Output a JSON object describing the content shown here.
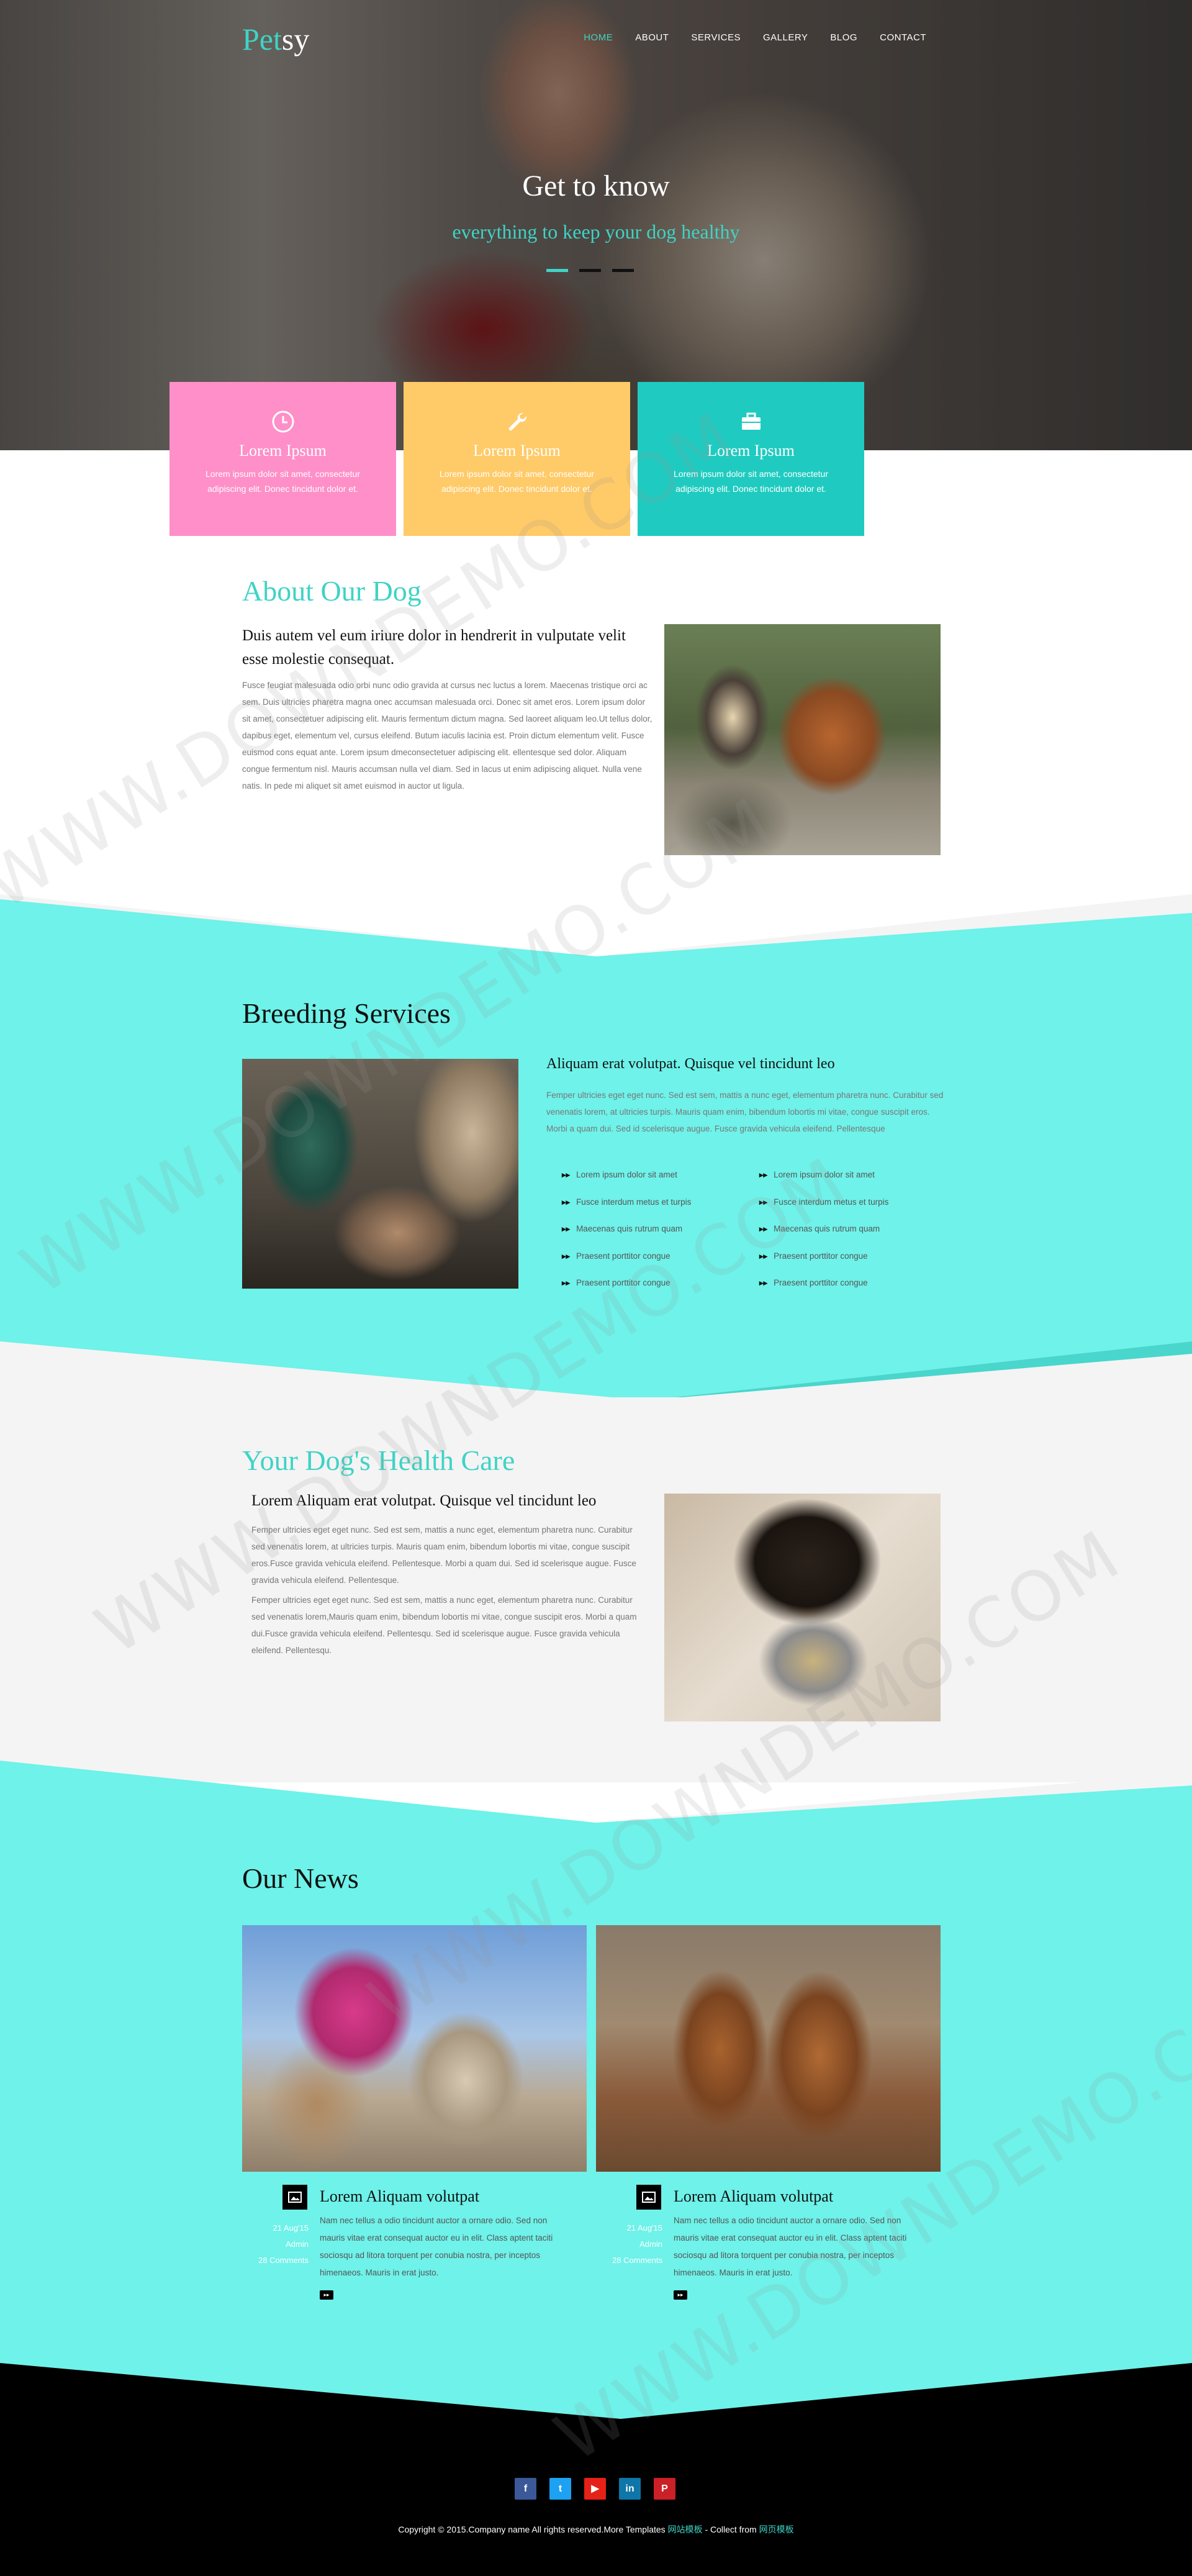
{
  "brand": {
    "part1": "Pet",
    "part2": "sy"
  },
  "nav": [
    {
      "label": "HOME",
      "active": true
    },
    {
      "label": "ABOUT",
      "active": false
    },
    {
      "label": "SERVICES",
      "active": false
    },
    {
      "label": "GALLERY",
      "active": false
    },
    {
      "label": "BLOG",
      "active": false
    },
    {
      "label": "CONTACT",
      "active": false
    }
  ],
  "hero": {
    "title": "Get to know",
    "subtitle": "everything to keep your dog healthy"
  },
  "features": [
    {
      "icon": "clock-icon",
      "title": "Lorem Ipsum",
      "text": "Lorem ipsum dolor sit amet, consectetur adipiscing elit. Donec tincidunt dolor et.",
      "color": "#ff8fc8"
    },
    {
      "icon": "wrench-icon",
      "title": "Lorem Ipsum",
      "text": "Lorem ipsum dolor sit amet, consectetur adipiscing elit. Donec tincidunt dolor et.",
      "color": "#ffca68"
    },
    {
      "icon": "briefcase-icon",
      "title": "Lorem Ipsum",
      "text": "Lorem ipsum dolor sit amet, consectetur adipiscing elit. Donec tincidunt dolor et.",
      "color": "#1fcbc0"
    }
  ],
  "about": {
    "title": "About Our Dog",
    "lead": "Duis autem vel eum iriure dolor in hendrerit in vulputate velit esse molestie consequat.",
    "text": "Fusce feugiat malesuada odio orbi nunc odio gravida at cursus nec luctus a lorem. Maecenas tristique orci ac sem. Duis ultricies pharetra magna onec accumsan malesuada orci. Donec sit amet eros. Lorem ipsum dolor sit amet, consectetuer adipiscing elit. Mauris fermentum dictum magna. Sed laoreet aliquam leo.Ut tellus dolor, dapibus eget, elementum vel, cursus eleifend. Butum iaculis lacinia est. Proin dictum elementum velit. Fusce euismod cons equat ante. Lorem ipsum dmeconsectetuer adipiscing elit. ellentesque sed dolor. Aliquam congue fermentum nisl. Mauris accumsan nulla vel diam. Sed in lacus ut enim adipiscing aliquet. Nulla vene natis. In pede mi aliquet sit amet euismod in auctor ut ligula."
  },
  "breeding": {
    "title": "Breeding Services",
    "lead": "Aliquam erat volutpat. Quisque vel tincidunt leo",
    "text": "Femper ultricies eget eget nunc. Sed est sem, mattis a nunc eget, elementum pharetra nunc. Curabitur sed venenatis lorem, at ultricies turpis. Mauris quam enim, bibendum lobortis mi vitae, congue suscipit eros. Morbi a quam dui. Sed id scelerisque augue. Fusce gravida vehicula eleifend. Pellentesque",
    "list_left": [
      "Lorem ipsum dolor sit amet",
      "Fusce interdum metus et turpis",
      "Maecenas quis rutrum quam",
      "Praesent porttitor congue",
      "Praesent porttitor congue"
    ],
    "list_right": [
      "Lorem ipsum dolor sit amet",
      "Fusce interdum metus et turpis",
      "Maecenas quis rutrum quam",
      "Praesent porttitor congue",
      "Praesent porttitor congue"
    ]
  },
  "health": {
    "title": "Your Dog's Health Care",
    "lead": "Lorem Aliquam erat volutpat. Quisque vel tincidunt leo",
    "text1": "Femper ultricies eget eget nunc. Sed est sem, mattis a nunc eget, elementum pharetra nunc. Curabitur sed venenatis lorem, at ultricies turpis. Mauris quam enim, bibendum lobortis mi vitae, congue suscipit eros.Fusce gravida vehicula eleifend. Pellentesque. Morbi a quam dui. Sed id scelerisque augue. Fusce gravida vehicula eleifend. Pellentesque.",
    "text2": "Femper ultricies eget eget nunc. Sed est sem, mattis a nunc eget, elementum pharetra nunc. Curabitur sed venenatis lorem,Mauris quam enim, bibendum lobortis mi vitae, congue suscipit eros. Morbi a quam dui.Fusce gravida vehicula eleifend. Pellentesqu. Sed id scelerisque augue. Fusce gravida vehicula eleifend. Pellentesqu."
  },
  "news": {
    "title": "Our News",
    "items": [
      {
        "date": "21 Aug'15",
        "author": "Admin",
        "comments": "28 Comments",
        "title": "Lorem Aliquam volutpat",
        "text": "Nam nec tellus a odio tincidunt auctor a ornare odio. Sed non mauris vitae erat consequat auctor eu in elit. Class aptent taciti sociosqu ad litora torquent per conubia nostra, per inceptos himenaeos. Mauris in erat justo."
      },
      {
        "date": "21 Aug'15",
        "author": "Admin",
        "comments": "28 Comments",
        "title": "Lorem Aliquam volutpat",
        "text": "Nam nec tellus a odio tincidunt auctor a ornare odio. Sed non mauris vitae erat consequat auctor eu in elit. Class aptent taciti sociosqu ad litora torquent per conubia nostra, per inceptos himenaeos. Mauris in erat justo."
      }
    ]
  },
  "footer": {
    "social": [
      {
        "icon": "facebook-icon",
        "glyph": "f",
        "color": "#3b5998"
      },
      {
        "icon": "twitter-icon",
        "glyph": "t",
        "color": "#1da1f2"
      },
      {
        "icon": "youtube-icon",
        "glyph": "▶",
        "color": "#e62117"
      },
      {
        "icon": "linkedin-icon",
        "glyph": "in",
        "color": "#0e76a8"
      },
      {
        "icon": "pinterest-icon",
        "glyph": "P",
        "color": "#cb2027"
      }
    ],
    "copyright": "Copyright © 2015.Company name All rights reserved.More Templates ",
    "link1": "网站模板",
    "mid": " - Collect from ",
    "link2": "网页模板"
  },
  "watermark": "WWW.DOWNDEMO.COM",
  "colors": {
    "accent": "#3fd3c6",
    "band": "#6ef2e9",
    "pink": "#ff8fc8",
    "yellow": "#ffca68",
    "teal": "#1fcbc0"
  }
}
